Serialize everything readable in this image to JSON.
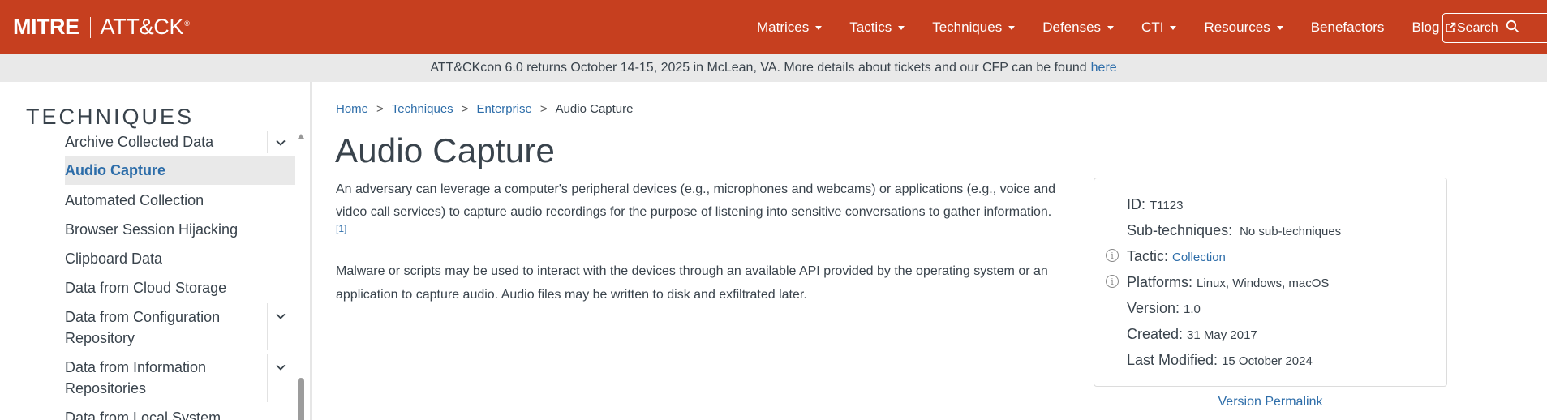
{
  "brand": {
    "mitre": "MITRE",
    "attck": "ATT&CK",
    "reg": "®"
  },
  "nav": {
    "items": [
      {
        "label": "Matrices",
        "dropdown": true
      },
      {
        "label": "Tactics",
        "dropdown": true
      },
      {
        "label": "Techniques",
        "dropdown": true
      },
      {
        "label": "Defenses",
        "dropdown": true
      },
      {
        "label": "CTI",
        "dropdown": true
      },
      {
        "label": "Resources",
        "dropdown": true
      },
      {
        "label": "Benefactors",
        "dropdown": false
      },
      {
        "label": "Blog",
        "dropdown": false,
        "external": true
      }
    ],
    "search_label": "Search"
  },
  "banner": {
    "text": "ATT&CKcon 6.0 returns October 14-15, 2025 in McLean, VA. More details about tickets and our CFP can be found",
    "link": "here"
  },
  "sidebar": {
    "title": "TECHNIQUES",
    "items": [
      {
        "label": "Archive Collected Data",
        "expandable": true,
        "active": false
      },
      {
        "label": "Audio Capture",
        "expandable": false,
        "active": true
      },
      {
        "label": "Automated Collection",
        "expandable": false,
        "active": false
      },
      {
        "label": "Browser Session Hijacking",
        "expandable": false,
        "active": false
      },
      {
        "label": "Clipboard Data",
        "expandable": false,
        "active": false
      },
      {
        "label": "Data from Cloud Storage",
        "expandable": false,
        "active": false
      },
      {
        "label_line1": "Data from Configuration",
        "label_line2": "Repository",
        "expandable": true,
        "active": false
      },
      {
        "label_line1": "Data from Information",
        "label_line2": "Repositories",
        "expandable": true,
        "active": false
      },
      {
        "label": "Data from Local System",
        "expandable": false,
        "active": false
      }
    ]
  },
  "breadcrumb": {
    "items": [
      "Home",
      "Techniques",
      "Enterprise"
    ],
    "current": "Audio Capture",
    "separator": ">"
  },
  "main": {
    "title": "Audio Capture",
    "para1_line1": "An adversary can leverage a computer's peripheral devices (e.g., microphones and webcams) or applications (e.g., voice and",
    "para1_line2": "video call services) to capture audio recordings for the purpose of listening into sensitive conversations to gather information.",
    "citation": "[1]",
    "para2_line1": "Malware or scripts may be used to interact with the devices through an available API provided by the operating system or an",
    "para2_line2": "application to capture audio. Audio files may be written to disk and exfiltrated later."
  },
  "card": {
    "id_label": "ID:",
    "id_value": "T1123",
    "subtech_label": "Sub-techniques:",
    "subtech_value": "No sub-techniques",
    "tactic_label": "Tactic:",
    "tactic_value": "Collection",
    "platforms_label": "Platforms:",
    "platforms_value": "Linux, Windows, macOS",
    "version_label": "Version:",
    "version_value": "1.0",
    "created_label": "Created:",
    "created_value": "31 May 2017",
    "modified_label": "Last Modified:",
    "modified_value": "15 October 2024",
    "info_glyph": "i"
  },
  "permalink": "Version Permalink",
  "colors": {
    "nav_bg": "#c63f1f",
    "banner_bg": "#e9e9e9",
    "link": "#2d6da9",
    "text": "#39434c",
    "active_bg": "#e9e9e9"
  }
}
